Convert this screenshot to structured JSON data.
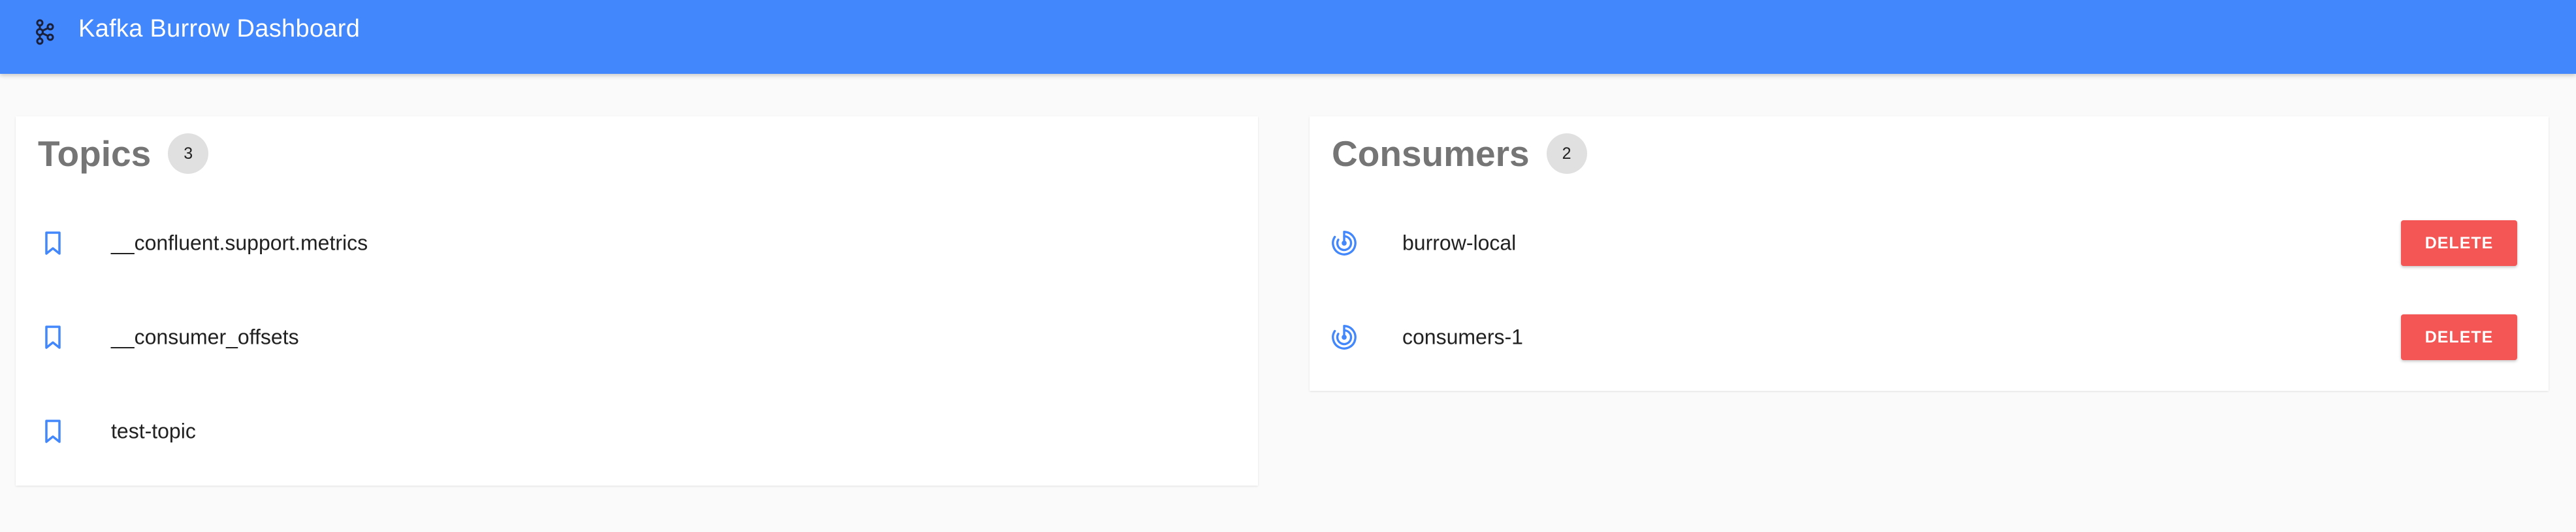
{
  "header": {
    "title": "Kafka Burrow Dashboard",
    "logo_icon": "kafka-logo-icon"
  },
  "topics": {
    "title": "Topics",
    "count": "3",
    "icon": "bookmark-icon",
    "items": [
      {
        "label": "__confluent.support.metrics"
      },
      {
        "label": "__consumer_offsets"
      },
      {
        "label": "test-topic"
      }
    ]
  },
  "consumers": {
    "title": "Consumers",
    "count": "2",
    "icon": "radar-icon",
    "delete_label": "DELETE",
    "items": [
      {
        "label": "burrow-local"
      },
      {
        "label": "consumers-1"
      }
    ]
  },
  "colors": {
    "appbar": "#4287fc",
    "accent_icon": "#4287fc",
    "delete": "#f45656",
    "title_gray": "#757575",
    "badge_bg": "#e0e0e0"
  }
}
